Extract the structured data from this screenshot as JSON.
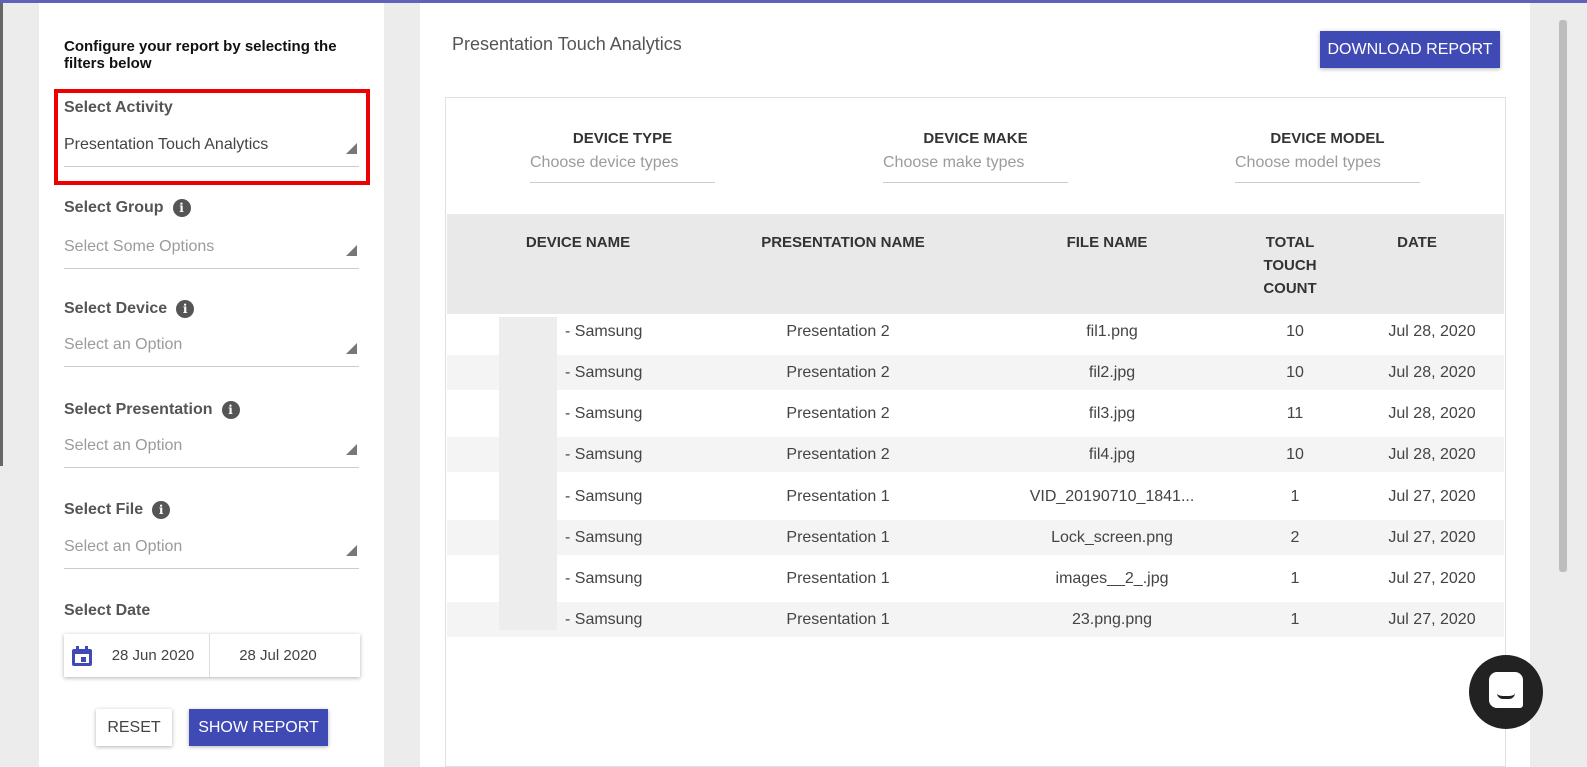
{
  "sidebar": {
    "intro": "Configure your report by selecting the filters below",
    "activity": {
      "label": "Select Activity",
      "value": "Presentation Touch Analytics"
    },
    "group": {
      "label": "Select Group",
      "placeholder": "Select Some Options"
    },
    "device": {
      "label": "Select Device",
      "placeholder": "Select an Option"
    },
    "presentation": {
      "label": "Select Presentation",
      "placeholder": "Select an Option"
    },
    "file": {
      "label": "Select File",
      "placeholder": "Select an Option"
    },
    "date": {
      "label": "Select Date",
      "from": "28 Jun 2020",
      "to": "28 Jul 2020"
    },
    "reset_label": "RESET",
    "show_label": "SHOW REPORT"
  },
  "main": {
    "title": "Presentation Touch Analytics",
    "download_label": "DOWNLOAD REPORT",
    "filters": {
      "device_type": {
        "label": "DEVICE TYPE",
        "placeholder": "Choose device types"
      },
      "device_make": {
        "label": "DEVICE MAKE",
        "placeholder": "Choose make types"
      },
      "device_model": {
        "label": "DEVICE MODEL",
        "placeholder": "Choose model types"
      }
    },
    "table": {
      "headers": {
        "device_name": "DEVICE NAME",
        "presentation_name": "PRESENTATION NAME",
        "file_name": "FILE NAME",
        "total_touch_count": "TOTAL TOUCH COUNT",
        "date": "DATE"
      },
      "rows": [
        {
          "device": "- Samsung",
          "presentation": "Presentation 2",
          "file": "fil1.png",
          "count": "10",
          "date": "Jul 28, 2020"
        },
        {
          "device": "- Samsung",
          "presentation": "Presentation 2",
          "file": "fil2.jpg",
          "count": "10",
          "date": "Jul 28, 2020"
        },
        {
          "device": "- Samsung",
          "presentation": "Presentation 2",
          "file": "fil3.jpg",
          "count": "11",
          "date": "Jul 28, 2020"
        },
        {
          "device": "- Samsung",
          "presentation": "Presentation 2",
          "file": "fil4.jpg",
          "count": "10",
          "date": "Jul 28, 2020"
        },
        {
          "device": "- Samsung",
          "presentation": "Presentation 1",
          "file": "VID_20190710_1841...",
          "count": "1",
          "date": "Jul 27, 2020"
        },
        {
          "device": "- Samsung",
          "presentation": "Presentation 1",
          "file": "Lock_screen.png",
          "count": "2",
          "date": "Jul 27, 2020"
        },
        {
          "device": "- Samsung",
          "presentation": "Presentation 1",
          "file": "images__2_.jpg",
          "count": "1",
          "date": "Jul 27, 2020"
        },
        {
          "device": "- Samsung",
          "presentation": "Presentation 1",
          "file": "23.png.png",
          "count": "1",
          "date": "Jul 27, 2020"
        }
      ]
    }
  },
  "icons": {
    "info": "info-icon",
    "dropdown": "dropdown-triangle-icon",
    "calendar": "calendar-icon",
    "chat": "chat-launcher-icon"
  },
  "colors": {
    "primary": "#3f4ab5",
    "highlight": "#ee0000"
  }
}
